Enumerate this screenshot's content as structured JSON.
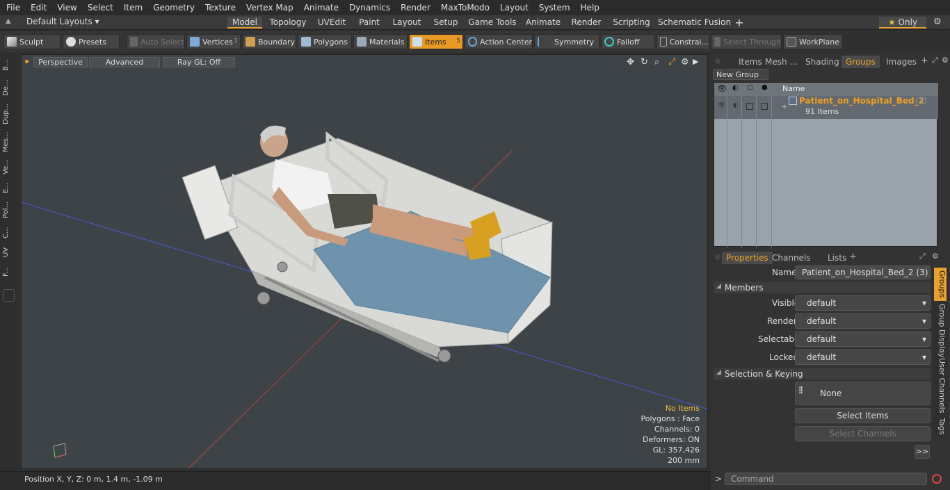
{
  "menu": [
    "File",
    "Edit",
    "View",
    "Select",
    "Item",
    "Geometry",
    "Texture",
    "Vertex Map",
    "Animate",
    "Dynamics",
    "Render",
    "MaxToModo",
    "Layout",
    "System",
    "Help"
  ],
  "layout_selector": "Default Layouts",
  "mode_tabs": [
    "Model",
    "Topology",
    "UVEdit",
    "Paint",
    "Layout",
    "Setup",
    "Game Tools",
    "Animate",
    "Render",
    "Scripting",
    "Schematic Fusion"
  ],
  "active_mode_tab": "Model",
  "only_label": "Only",
  "toolbar": {
    "sculpt": "Sculpt",
    "presets": "Presets",
    "auto_select": "Auto Select",
    "vertices": "Vertices",
    "vertices_count": "1",
    "boundary": "Boundary",
    "polygons": "Polygons",
    "materials": "Materials",
    "items": "Items",
    "items_count": "5",
    "action_center": "Action Center",
    "symmetry": "Symmetry",
    "falloff": "Falloff",
    "constraints": "Constrai...",
    "select_through": "Select Through",
    "workplane": "WorkPlane"
  },
  "left_tabs": [
    "B...",
    "De...",
    "Dup...",
    "Mes...",
    "Ve...",
    "E...",
    "Pol...",
    "C...",
    "UV",
    "F..."
  ],
  "viewport": {
    "view": "Perspective",
    "shading": "Advanced",
    "raygl": "Ray GL: Off",
    "info": {
      "selection": "No Items",
      "polygons": "Polygons : Face",
      "channels": "Channels: 0",
      "deformers": "Deformers: ON",
      "gl": "GL: 357,426",
      "unit": "200 mm"
    }
  },
  "status": "Position X, Y, Z:   0 m, 1.4 m, -1.09 m",
  "right_tabs": [
    "Items",
    "Mesh ...",
    "Shading",
    "Groups",
    "Images"
  ],
  "active_right_tab": "Groups",
  "groups": {
    "new_group": "New Group",
    "col_name": "Name",
    "item_name": "Patient_on_Hospital_Bed_2",
    "item_count": "(3)",
    "item_sub": "91 Items"
  },
  "prop_tabs": [
    "Properties",
    "Channels",
    "Lists"
  ],
  "properties": {
    "name_label": "Name",
    "name_value": "Patient_on_Hospital_Bed_2 (3)",
    "members": "Members",
    "visible_label": "Visible",
    "visible": "default",
    "render_label": "Render",
    "render": "default",
    "selectable_label": "Selectable",
    "selectable": "default",
    "locked_label": "Locked",
    "locked": "default",
    "sel_keying": "Selection & Keying",
    "none": "None",
    "select_items": "Select Items",
    "select_channels": "Select Channels",
    "more": ">>"
  },
  "side_vtabs": [
    "Groups",
    "Group Display",
    "User Channels",
    "Tags"
  ],
  "command_placeholder": "Command"
}
